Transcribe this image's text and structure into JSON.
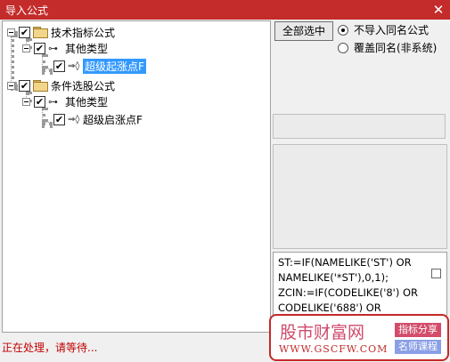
{
  "window": {
    "title": "导入公式",
    "close_icon": "close-icon"
  },
  "tree": {
    "nodes": [
      {
        "label": "技术指标公式",
        "checked": true,
        "kind": "folder"
      },
      {
        "label": "其他类型",
        "checked": true,
        "kind": "category"
      },
      {
        "label": "超级起涨点F",
        "checked": true,
        "kind": "formula",
        "selected": true
      },
      {
        "label": "条件选股公式",
        "checked": true,
        "kind": "folder"
      },
      {
        "label": "其他类型",
        "checked": true,
        "kind": "category"
      },
      {
        "label": "超级启涨点F",
        "checked": true,
        "kind": "formula"
      }
    ]
  },
  "options": {
    "select_all_label": "全部选中",
    "radio_no_import": "不导入同名公式",
    "radio_overwrite": "覆盖同名(非系统)"
  },
  "code_lines": [
    "ST:=IF(NAMELIKE('ST') OR",
    "NAMELIKE('*ST'),0,1);",
    "ZCIN:=IF(CODELIKE('8') OR",
    "CODELIKE('688') OR"
  ],
  "status_text": "正在处理，请等待...",
  "watermark": {
    "brand": "股市财富网",
    "url": "WWW.GSCFW.COM",
    "tag1": "指标分享",
    "tag2": "名师课程"
  },
  "colors": {
    "titlebar": "#c42b2b",
    "selection": "#3399ff",
    "status": "#c00000"
  }
}
